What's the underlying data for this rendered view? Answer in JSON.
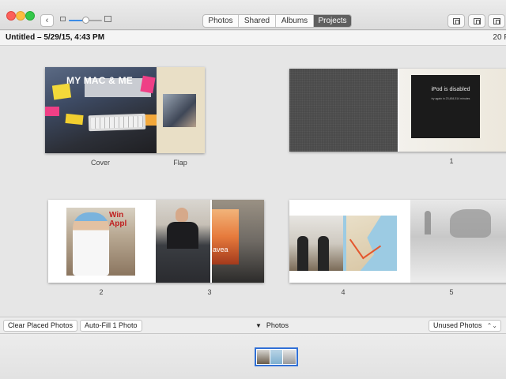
{
  "window": {
    "back_label": "‹",
    "view_tabs": [
      {
        "label": "Photos",
        "active": false
      },
      {
        "label": "Shared",
        "active": false
      },
      {
        "label": "Albums",
        "active": false
      },
      {
        "label": "Projects",
        "active": true
      }
    ],
    "zoom_level": 0.5,
    "toolbar_icons": [
      "add-to-project-icon",
      "layout-icon",
      "book-settings-icon"
    ]
  },
  "document": {
    "title": "Untitled – 5/29/15, 4:43 PM",
    "page_count": "20 P"
  },
  "spreads": [
    {
      "pages": [
        {
          "caption": "Cover",
          "cover_text": "MY MAC & ME"
        },
        {
          "caption": "Flap"
        }
      ]
    },
    {
      "caption": "1",
      "ipod_text": "iPod is disabled",
      "ipod_subtext": "try again in 23,484,514 minutes"
    },
    {
      "caption": "2",
      "sign_text": "Win Appl"
    },
    {
      "caption": "3",
      "poster_text": "avea"
    },
    {
      "caption": "4"
    },
    {
      "caption": "5"
    }
  ],
  "bottom_bar": {
    "clear_label": "Clear Placed Photos",
    "autofill_label": "Auto-Fill 1 Photo",
    "photos_label": "Photos",
    "filter_value": "Unused Photos"
  },
  "colors": {
    "accent": "#2f6fd6",
    "active_tab": "#5f5f5f",
    "close": "#fc605b",
    "minimize": "#fdbc40",
    "maximize": "#34c84a"
  }
}
